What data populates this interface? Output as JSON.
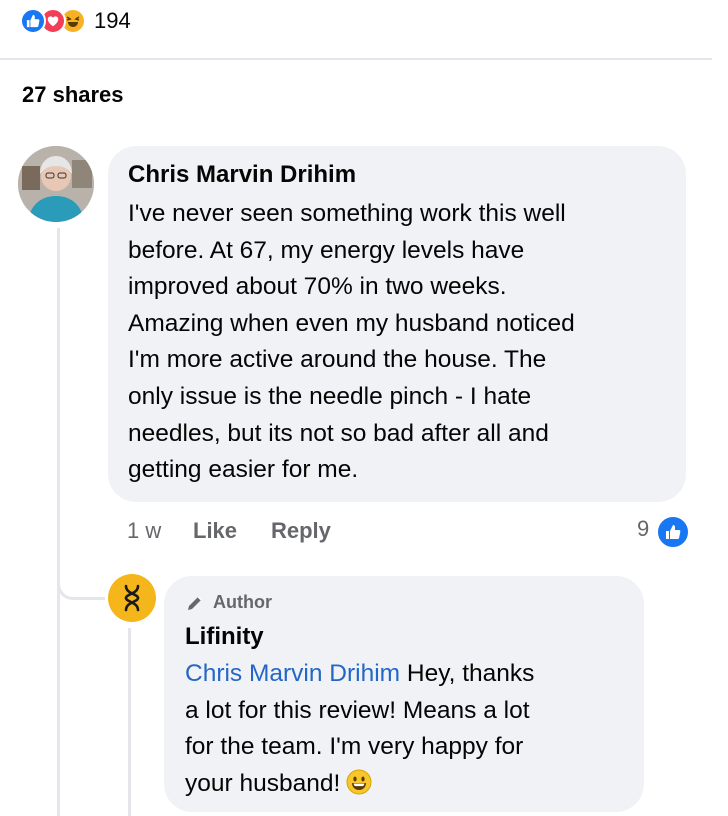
{
  "post": {
    "reaction_count": "194",
    "shares": "27 shares",
    "reaction_icons": [
      "like-icon",
      "love-icon",
      "haha-icon"
    ]
  },
  "comment": {
    "author": "Chris Marvin Drihim",
    "lines": [
      "I've never seen something work this well",
      "before. At 67, my energy levels have",
      "improved about 70% in two weeks.",
      "Amazing when even my husband noticed",
      "I'm more active around the house. The",
      "only issue is the needle pinch - I hate",
      "needles, but its not so bad after all and",
      "getting easier for me."
    ],
    "time": "1 w",
    "like_label": "Like",
    "reply_label": "Reply",
    "like_count": "9"
  },
  "reply": {
    "badge": "Author",
    "author": "Lifinity",
    "mention": "Chris Marvin Drihim",
    "line1_rest": " Hey, thanks",
    "lines": [
      "a lot for this review! Means a lot",
      "for the team. I'm very happy for"
    ],
    "last_line": "your husband!"
  },
  "colors": {
    "accent": "#1877f2",
    "mention": "#2466c7",
    "bubble": "#f0f2f5",
    "muted_text": "#65676b",
    "love": "#f33e58",
    "haha": "#f7b125",
    "author_avatar": "#f5b61c"
  }
}
